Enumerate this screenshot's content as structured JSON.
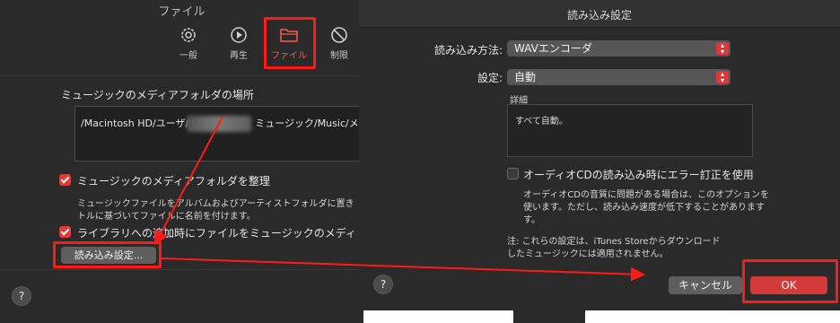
{
  "left": {
    "title": "ファイル",
    "toolbar": [
      {
        "label": "一般",
        "icon": "gear-icon"
      },
      {
        "label": "再生",
        "icon": "play-icon"
      },
      {
        "label": "ファイル",
        "icon": "folder-icon",
        "selected": true
      },
      {
        "label": "制限",
        "icon": "prohibit-icon"
      }
    ],
    "media_folder_heading": "ミュージックのメディアフォルダの場所",
    "path_prefix": "/Macintosh HD/ユーザ/",
    "path_suffix": "ミュージック/Music/メデ",
    "organize_label": "ミュージックのメディアフォルダを整理",
    "organize_desc_1": "ミュージックファイルをアルバムおよびアーティストフォルダに置き",
    "organize_desc_2": "トルに基づいてファイルに名前を付けます。",
    "copy_label": "ライブラリへの追加時にファイルをミュージックのメディ",
    "import_settings_button": "読み込み設定...",
    "help": "?"
  },
  "dialog": {
    "title": "読み込み設定",
    "import_using_label": "読み込み方法:",
    "import_using_value": "WAVエンコーダ",
    "setting_label": "設定:",
    "setting_value": "自動",
    "details_label": "詳細",
    "details_text": "すべて自動。",
    "error_correction_label": "オーディオCDの読み込み時にエラー訂正を使用",
    "error_desc_1": "オーディオCDの音質に問題がある場合は、このオプションを",
    "error_desc_2": "使います。ただし、読み込み速度が低下することがあります",
    "error_desc_3": "す。",
    "note_1": "注: これらの設定は、iTunes Storeからダウンロード",
    "note_2": "したミュージックには適用されません。",
    "cancel_button": "キャンセル",
    "ok_button": "OK",
    "help": "?"
  },
  "colors": {
    "highlight": "#ff1a1a",
    "accent": "#e0353a"
  }
}
